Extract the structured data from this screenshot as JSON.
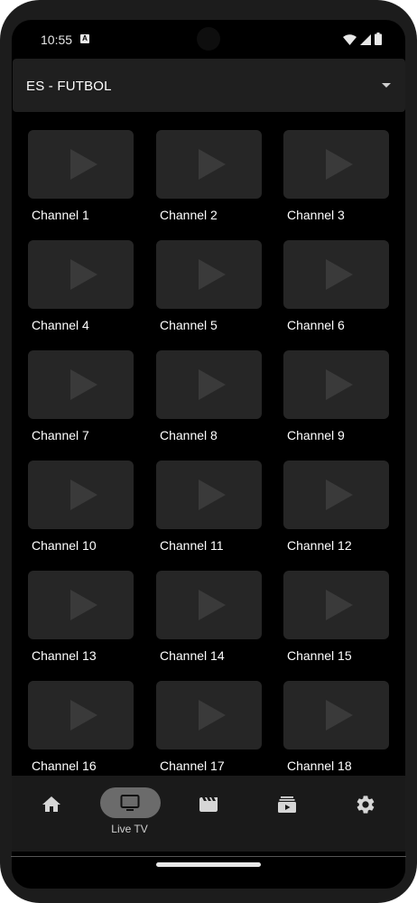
{
  "status_bar": {
    "time": "10:55",
    "badge": "A"
  },
  "category_selector": {
    "selected": "ES - FUTBOL"
  },
  "channels": [
    "Channel 1",
    "Channel 2",
    "Channel 3",
    "Channel 4",
    "Channel 5",
    "Channel 6",
    "Channel 7",
    "Channel 8",
    "Channel 9",
    "Channel 10",
    "Channel 11",
    "Channel 12",
    "Channel 13",
    "Channel 14",
    "Channel 15",
    "Channel 16",
    "Channel 17",
    "Channel 18"
  ],
  "bottom_nav": {
    "items": [
      {
        "icon": "home-icon",
        "label": ""
      },
      {
        "icon": "tv-icon",
        "label": "Live TV",
        "active": true
      },
      {
        "icon": "movie-icon",
        "label": ""
      },
      {
        "icon": "series-icon",
        "label": ""
      },
      {
        "icon": "settings-icon",
        "label": ""
      }
    ]
  },
  "colors": {
    "background": "#000000",
    "surface": "#1f1f1f",
    "thumbnail": "#262626",
    "active_pill": "#6b6b6b",
    "text": "#ffffff"
  }
}
